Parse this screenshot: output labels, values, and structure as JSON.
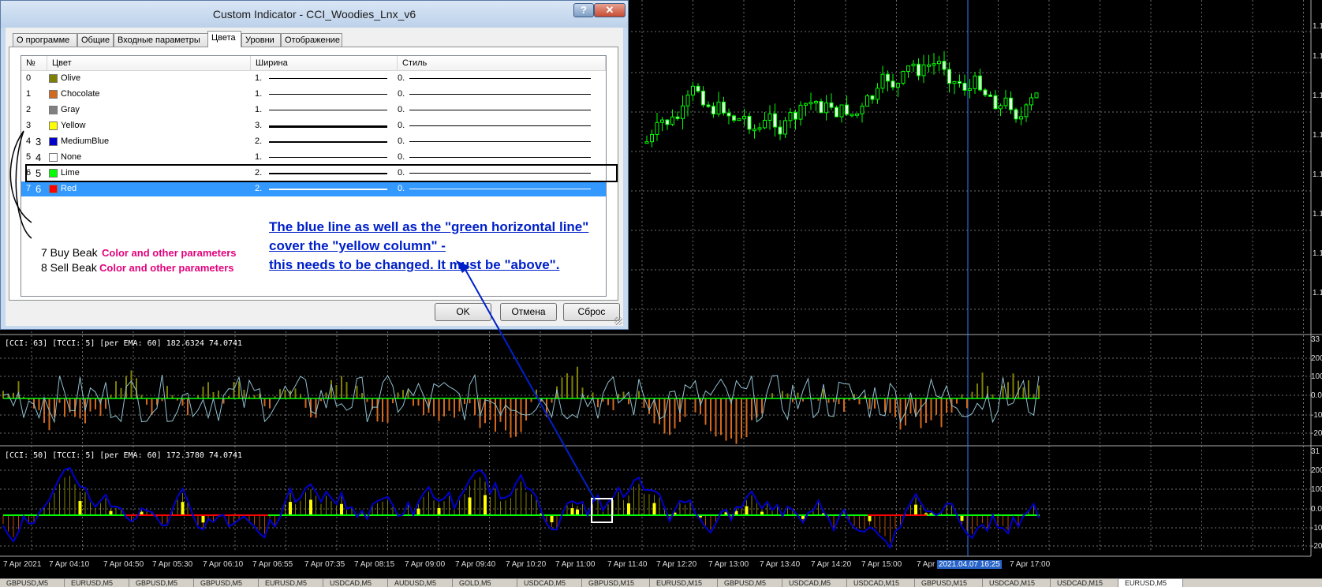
{
  "dialog": {
    "title": "Custom Indicator - CCI_Woodies_Lnx_v6",
    "help_label": "?",
    "close_label": "✕",
    "tabs": [
      {
        "label": "О программе",
        "active": false
      },
      {
        "label": "Общие",
        "active": false
      },
      {
        "label": "Входные параметры",
        "active": false
      },
      {
        "label": "Цвета",
        "active": true
      },
      {
        "label": "Уровни",
        "active": false
      },
      {
        "label": "Отображение",
        "active": false
      }
    ],
    "columns": [
      "№",
      "Цвет",
      "Ширина",
      "Стиль"
    ],
    "rows": [
      {
        "num": "0",
        "num2": "",
        "color_name": "Olive",
        "swatch": "#808000",
        "width": "1.",
        "style": "0.",
        "selected": false
      },
      {
        "num": "1",
        "num2": "",
        "color_name": "Chocolate",
        "swatch": "#d2691e",
        "width": "1.",
        "style": "0.",
        "selected": false
      },
      {
        "num": "2",
        "num2": "",
        "color_name": "Gray",
        "swatch": "#808080",
        "width": "1.",
        "style": "0.",
        "selected": false
      },
      {
        "num": "3",
        "num2": "",
        "color_name": "Yellow",
        "swatch": "#ffff00",
        "width": "3.",
        "style": "0.",
        "selected": false
      },
      {
        "num": "4",
        "num2": "3",
        "color_name": "MediumBlue",
        "swatch": "#0000cd",
        "width": "2.",
        "style": "0.",
        "selected": false
      },
      {
        "num": "5",
        "num2": "4",
        "color_name": "None",
        "swatch": "#ffffff",
        "width": "1.",
        "style": "0.",
        "selected": false
      },
      {
        "num": "6",
        "num2": "5",
        "color_name": "Lime",
        "swatch": "#00ff00",
        "width": "2.",
        "style": "0.",
        "selected": false
      },
      {
        "num": "7",
        "num2": "6",
        "color_name": "Red",
        "swatch": "#ff0000",
        "width": "2.",
        "style": "0.",
        "selected": true
      }
    ],
    "extra_buffers": [
      {
        "label": "7 Buy Beak",
        "note": "Color and other parameters"
      },
      {
        "label": "8 Sell Beak",
        "note": "Color and other parameters"
      }
    ],
    "annotation": [
      "The blue line as well as the \"green horizontal line\"",
      "cover the \"yellow column\" -",
      "this needs to be changed. It must be \"above\"."
    ],
    "buttons": {
      "ok": "OK",
      "cancel": "Отмена",
      "reset": "Сброс"
    }
  },
  "indicators": {
    "cci1_label": "[CCI: 63] [TCCI: 5] [per EMA: 60]  182.6324 74.0741",
    "cci2_label": "[CCI: 50] [TCCI: 5] [per EMA: 60]  172.3780 74.0741"
  },
  "price_axis": [
    "1.1",
    "1.1",
    "1.1",
    "1.1",
    "1.1",
    "1.1",
    "1.1",
    "1.1"
  ],
  "cci1_axis": [
    "33",
    "200",
    "100",
    "0.0",
    "-10",
    "-20"
  ],
  "cci2_axis": [
    "31",
    "200",
    "100",
    "0.0",
    "-10",
    "-20"
  ],
  "time_axis": [
    "7 Apr 2021",
    "7 Apr 04:10",
    "7 Apr 04:50",
    "7 Apr 05:30",
    "7 Apr 06:10",
    "7 Apr 06:55",
    "7 Apr 07:35",
    "7 Apr 08:15",
    "7 Apr 09:00",
    "7 Apr 09:40",
    "7 Apr 10:20",
    "7 Apr 11:00",
    "7 Apr 11:40",
    "7 Apr 12:20",
    "7 Apr 13:00",
    "7 Apr 13:40",
    "7 Apr 14:20",
    "7 Apr 15:00",
    "7 Apr 1",
    "7 Apr 17:00"
  ],
  "crosshair_time": "2021.04.07 16:25",
  "symbol_tabs": [
    "GBPUSD,M5",
    "EURUSD,M5",
    "GBPUSD,M5",
    "GBPUSD,M5",
    "EURUSD,M5",
    "USDCAD,M5",
    "AUDUSD,M5",
    "GOLD,M5",
    "USDCAD,M5",
    "GBPUSD,M15",
    "EURUSD,M15",
    "GBPUSD,M5",
    "USDCAD,M5",
    "USDCAD,M15",
    "GBPUSD,M15",
    "USDCAD,M15",
    "USDCAD,M15",
    "EURUSD,M5"
  ],
  "colors": {
    "grid": "#6e6e6e",
    "olive": "#808000",
    "chocolate": "#d2691e",
    "yellow": "#ffff00",
    "blue": "#0000cd",
    "lime": "#00ff00",
    "red": "#ff0000",
    "cyan_line": "#8fbfcf",
    "crosshair": "#2f7fff"
  }
}
